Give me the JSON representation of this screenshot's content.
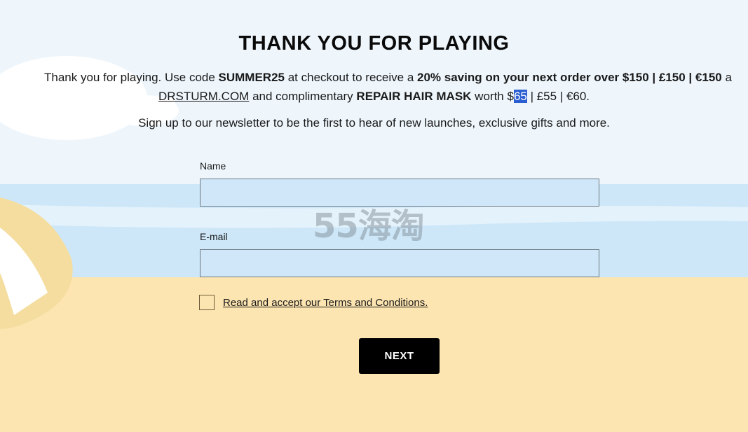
{
  "page": {
    "heading": "THANK YOU FOR PLAYING",
    "promo": {
      "line1_start": "Thank you for playing. Use code ",
      "code": "SUMMER25",
      "line1_mid": " at checkout to receive a ",
      "offer": "20% saving on your next order over $150 | £150 | €150",
      "line1_end": " a",
      "site_link": "DRSTURM.COM",
      "line2_mid": " and complimentary ",
      "gift": "REPAIR HAIR MASK",
      "worth": " worth $",
      "price_selected": "65",
      "price_rest": " | £55 | €60."
    },
    "subtitle": "Sign up to our newsletter to be the first to hear of new launches, exclusive gifts and more."
  },
  "form": {
    "name_label": "Name",
    "name_value": "",
    "email_label": "E-mail",
    "email_value": "",
    "terms_checked": false,
    "terms_label": "Read and accept our Terms and Conditions.",
    "next_label": "NEXT"
  },
  "watermark": "55海淘",
  "colors": {
    "sky": "#eef6fc",
    "sea": "#cde7f8",
    "sand": "#fde5b1",
    "button": "#000000",
    "selection": "#2b5fd1"
  }
}
